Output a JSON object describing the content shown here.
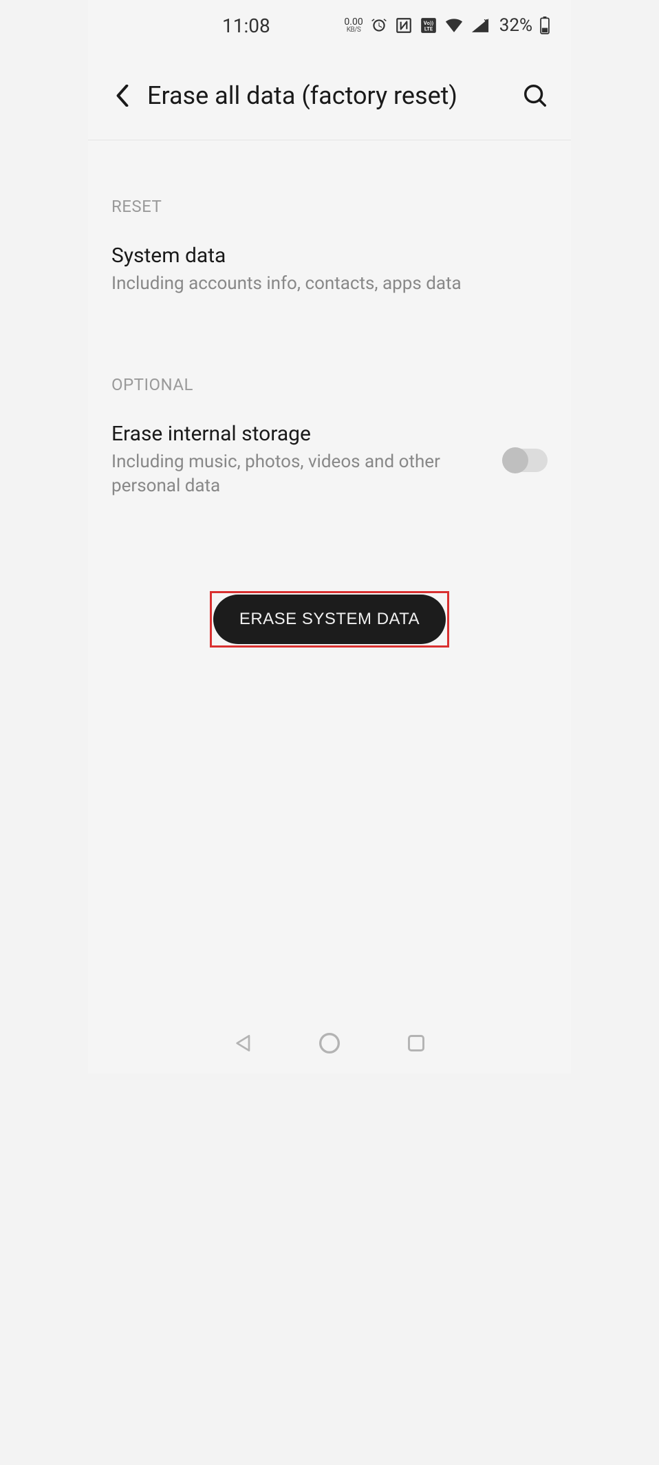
{
  "status": {
    "time": "11:08",
    "net_speed_value": "0.00",
    "net_speed_unit": "KB/S",
    "battery_pct": "32%"
  },
  "header": {
    "title": "Erase all data (factory reset)"
  },
  "sections": {
    "reset": {
      "label": "RESET",
      "item": {
        "title": "System data",
        "desc": "Including accounts info, contacts, apps data"
      }
    },
    "optional": {
      "label": "OPTIONAL",
      "item": {
        "title": "Erase internal storage",
        "desc": "Including music, photos, videos and other personal data",
        "toggle_on": false
      }
    }
  },
  "action": {
    "erase_label": "ERASE SYSTEM DATA"
  }
}
